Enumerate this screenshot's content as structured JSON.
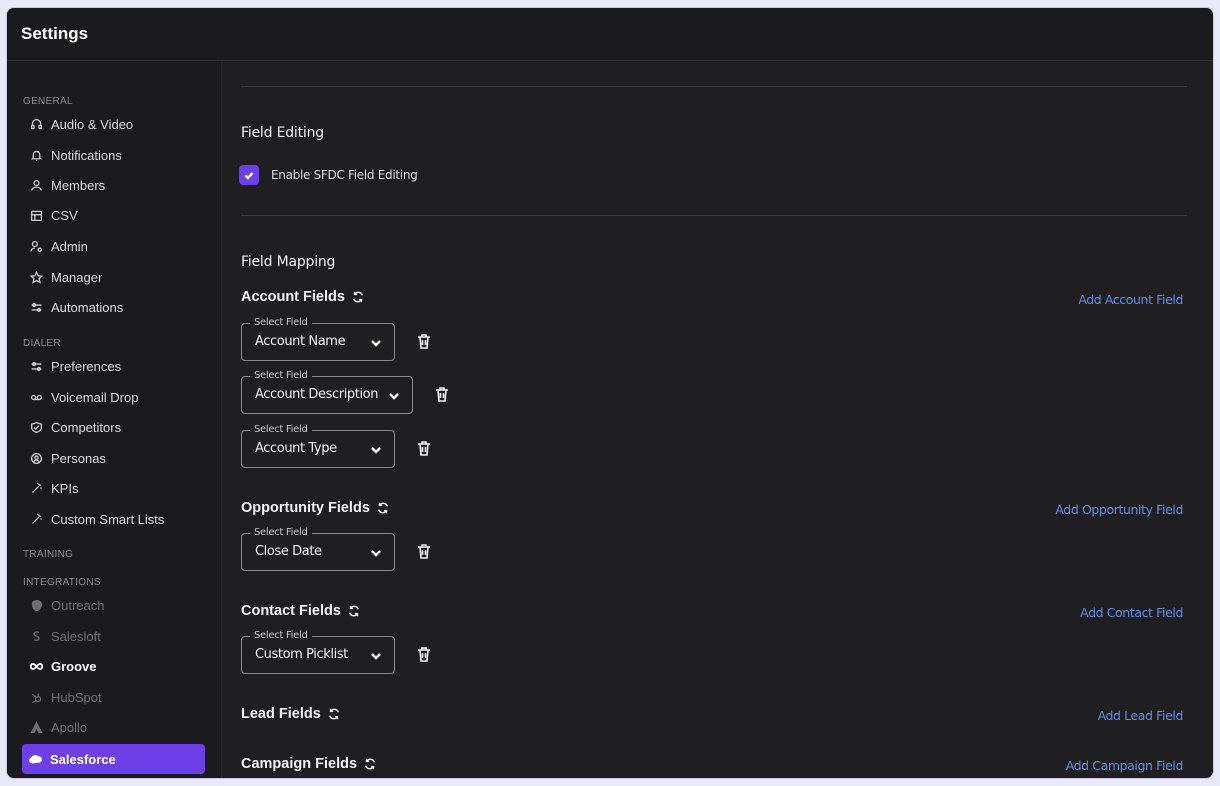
{
  "window": {
    "title": "Settings"
  },
  "sidebar": {
    "sections": [
      {
        "label": "GENERAL"
      },
      {
        "label": "DIALER"
      },
      {
        "label": "TRAINING"
      },
      {
        "label": "INTEGRATIONS"
      }
    ],
    "general": [
      {
        "label": "Audio & Video",
        "icon": "headset-icon"
      },
      {
        "label": "Notifications",
        "icon": "bell-icon"
      },
      {
        "label": "Members",
        "icon": "user-icon"
      },
      {
        "label": "CSV",
        "icon": "csv-icon"
      },
      {
        "label": "Admin",
        "icon": "admin-icon"
      },
      {
        "label": "Manager",
        "icon": "star-icon"
      },
      {
        "label": "Automations",
        "icon": "sliders-icon"
      }
    ],
    "dialer": [
      {
        "label": "Preferences",
        "icon": "sliders-icon"
      },
      {
        "label": "Voicemail Drop",
        "icon": "voicemail-icon"
      },
      {
        "label": "Competitors",
        "icon": "competitors-icon"
      },
      {
        "label": "Personas",
        "icon": "persona-icon"
      },
      {
        "label": "KPIs",
        "icon": "magic-wand-icon"
      },
      {
        "label": "Custom Smart Lists",
        "icon": "magic-wand-icon"
      }
    ],
    "integrations": [
      {
        "label": "Outreach",
        "icon": "outreach-icon",
        "state": "disabled"
      },
      {
        "label": "Salesloft",
        "icon": "salesloft-icon",
        "state": "disabled"
      },
      {
        "label": "Groove",
        "icon": "infinity-icon",
        "state": "enabled"
      },
      {
        "label": "HubSpot",
        "icon": "hubspot-icon",
        "state": "disabled"
      },
      {
        "label": "Apollo",
        "icon": "apollo-icon",
        "state": "disabled"
      },
      {
        "label": "Salesforce",
        "icon": "cloud-icon",
        "state": "active"
      }
    ]
  },
  "main": {
    "field_editing": {
      "title": "Field Editing",
      "checkbox_label": "Enable SFDC Field Editing",
      "checked": true
    },
    "field_mapping": {
      "title": "Field Mapping",
      "select_legend": "Select Field",
      "groups": [
        {
          "title": "Account Fields",
          "add_label": "Add Account Field",
          "fields": [
            "Account Name",
            "Account Description",
            "Account Type"
          ]
        },
        {
          "title": "Opportunity Fields",
          "add_label": "Add Opportunity Field",
          "fields": [
            "Close Date"
          ]
        },
        {
          "title": "Contact Fields",
          "add_label": "Add Contact Field",
          "fields": [
            "Custom Picklist"
          ]
        },
        {
          "title": "Lead Fields",
          "add_label": "Add Lead Field",
          "fields": []
        },
        {
          "title": "Campaign Fields",
          "add_label": "Add Campaign Field",
          "fields": []
        }
      ]
    }
  },
  "colors": {
    "accent": "#6d3fe6",
    "link": "#5b8dee",
    "background": "#1f1f21"
  }
}
